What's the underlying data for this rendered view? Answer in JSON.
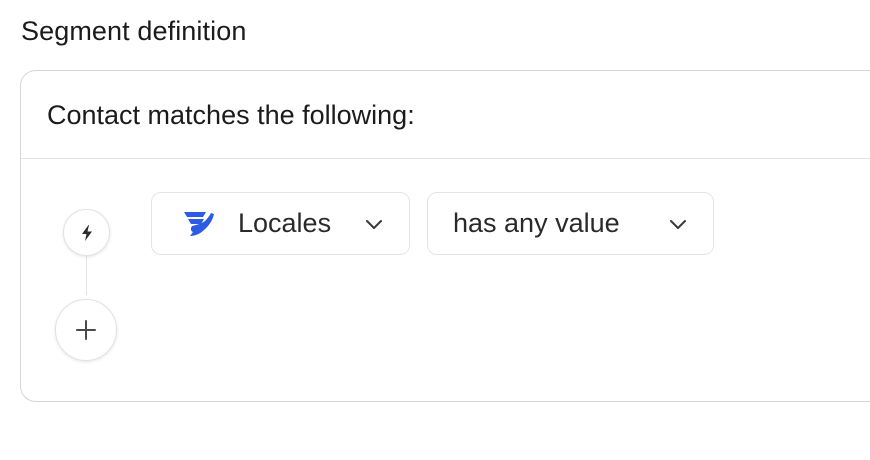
{
  "section": {
    "title": "Segment definition"
  },
  "card": {
    "header": "Contact matches the following:"
  },
  "condition": {
    "attribute": {
      "icon": "bird-logo-icon",
      "label": "Locales"
    },
    "operator": {
      "label": "has any value"
    }
  },
  "icons": {
    "trigger": "lightning-bolt-icon",
    "add": "plus-icon",
    "dropdown": "chevron-down-icon"
  },
  "colors": {
    "brand_blue": "#2d5be3"
  }
}
